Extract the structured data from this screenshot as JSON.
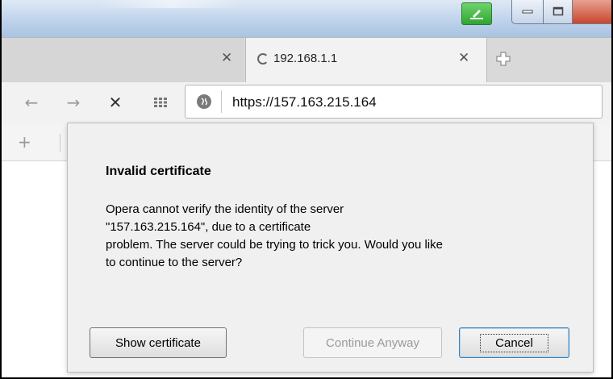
{
  "tabs": [
    {
      "title": "",
      "active": false
    },
    {
      "title": "192.168.1.1",
      "active": true,
      "loading": true
    }
  ],
  "address_bar": {
    "url": "https://157.163.215.164"
  },
  "dialog": {
    "title": "Invalid certificate",
    "message": "Opera cannot verify the identity of the server \"157.163.215.164\", due to a certificate problem. The server could be trying to trick you. Would you like to continue to the server?",
    "message_lines": [
      "Opera cannot verify the identity of the server",
      "\"157.163.215.164\", due to a certificate",
      "problem. The server could be trying to trick you. Would you like",
      "to continue to the server?"
    ],
    "buttons": {
      "show_certificate": "Show certificate",
      "continue_anyway": "Continue Anyway",
      "cancel": "Cancel"
    }
  },
  "colors": {
    "titlebar": "#bcd1ea",
    "tabstrip": "#d9d9d9",
    "dialog_bg": "#f0f0f0",
    "opera_badge": "#2ea52e",
    "close_button": "#c9462c"
  },
  "icons": [
    "back-arrow-icon",
    "forward-arrow-icon",
    "stop-icon",
    "speed-dial-icon",
    "globe-icon",
    "new-tab-icon",
    "close-tab-icon",
    "add-bookmark-icon"
  ]
}
